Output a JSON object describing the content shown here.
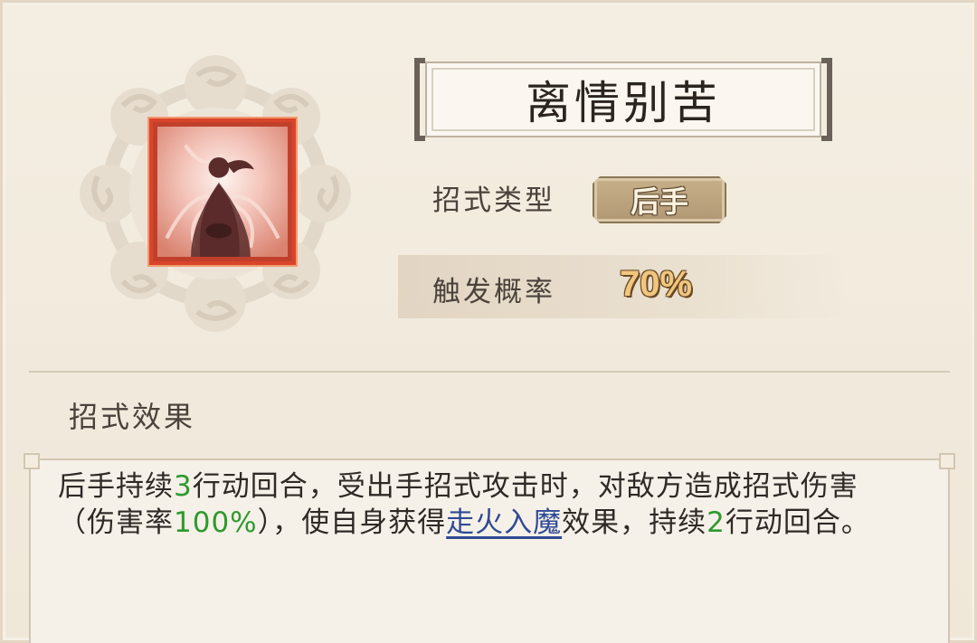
{
  "skill": {
    "name": "离情别苦",
    "icon": "meditating-figure-icon",
    "type_label": "招式类型",
    "type_value": "后手",
    "probability_label": "触发概率",
    "probability_value": "70%"
  },
  "effect": {
    "section_label": "招式效果",
    "parts": {
      "p1": "后手持续",
      "n1": "3",
      "p2": "行动回合，受出手招式攻击时，对敌方造成招式伤害（伤害率",
      "n2": "100%",
      "p3": "），使自身获得",
      "link": "走火入魔",
      "p4": "效果，持续",
      "n3": "2",
      "p5": "行动回合。"
    }
  },
  "colors": {
    "highlight_number": "#2e9a2e",
    "link": "#2f4a95",
    "icon_border": "#d9452a",
    "badge_bg": "#b19874",
    "probability_text": "#f1c67f"
  }
}
